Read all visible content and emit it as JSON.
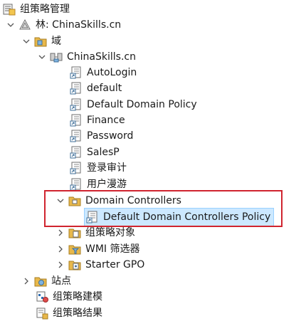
{
  "tree": {
    "root": {
      "label": "组策略管理",
      "icon": "gpmc-root-icon"
    },
    "forest": {
      "label": "林: ChinaSkills.cn",
      "icon": "forest-icon",
      "expanded": true
    },
    "domains": {
      "label": "域",
      "icon": "domains-folder-icon",
      "expanded": true
    },
    "domain": {
      "label": "ChinaSkills.cn",
      "icon": "domain-icon",
      "expanded": true
    },
    "gpo_links": [
      {
        "label": "AutoLogin",
        "icon": "gpo-link-icon"
      },
      {
        "label": "default",
        "icon": "gpo-link-icon"
      },
      {
        "label": "Default Domain Policy",
        "icon": "gpo-link-icon"
      },
      {
        "label": "Finance",
        "icon": "gpo-link-icon"
      },
      {
        "label": "Password",
        "icon": "gpo-link-icon"
      },
      {
        "label": "SalesP",
        "icon": "gpo-link-icon"
      },
      {
        "label": "登录审计",
        "icon": "gpo-link-icon"
      },
      {
        "label": "用户漫游",
        "icon": "gpo-link-icon"
      }
    ],
    "domain_controllers": {
      "label": "Domain Controllers",
      "icon": "ou-folder-icon",
      "expanded": true
    },
    "dc_policy": {
      "label": "Default Domain Controllers Policy",
      "icon": "gpo-link-icon",
      "selected": true
    },
    "gpo_objects": {
      "label": "组策略对象",
      "icon": "gpo-folder-icon",
      "expanded": false
    },
    "wmi_filters": {
      "label": "WMI 筛选器",
      "icon": "wmi-folder-icon",
      "expanded": false
    },
    "starter_gpo": {
      "label": "Starter GPO",
      "icon": "starter-gpo-folder-icon",
      "expanded": false
    },
    "sites": {
      "label": "站点",
      "icon": "sites-icon",
      "expanded": false
    },
    "modeling": {
      "label": "组策略建模",
      "icon": "modeling-icon"
    },
    "results": {
      "label": "组策略结果",
      "icon": "results-icon"
    }
  },
  "colors": {
    "selection_bg": "#cce8ff",
    "selection_border": "#99d1ff",
    "highlight_box": "#d0242f",
    "folder_yellow": "#e8b84a"
  }
}
